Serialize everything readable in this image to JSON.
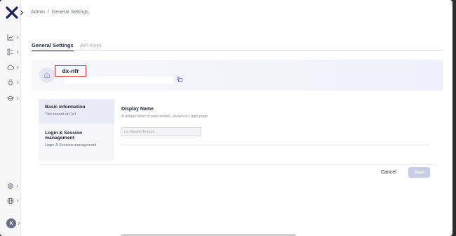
{
  "breadcrumb": {
    "root": "Admin",
    "separator": "/",
    "current": "General Settings"
  },
  "tabs": [
    {
      "label": "General Settings",
      "active": true
    },
    {
      "label": "API Keys",
      "active": false
    }
  ],
  "tenant": {
    "name": "dx-nfr",
    "id_value": ""
  },
  "side_tabs": [
    {
      "title": "Basic information",
      "subtitle": "This tenant at Cx1"
    },
    {
      "title": "Login & Session management",
      "subtitle": "Login & Session management"
    }
  ],
  "form": {
    "display_name_label": "Display Name",
    "display_name_desc": "A unique label of your tenant, shown in Login page",
    "display_name_placeholder": "i.e. MasterTenant"
  },
  "footer": {
    "cancel_label": "Cancel",
    "save_label": "Save"
  },
  "user": {
    "avatar_initial": "K"
  },
  "sidebar_icons": [
    "chart-icon",
    "list-icon",
    "cloud-icon",
    "bug-icon",
    "graduation-cap-icon",
    "settings-icon",
    "globe-icon"
  ],
  "colors": {
    "accent": "#1f2235",
    "save_disabled": "#c9cce6",
    "highlight_border": "#d9302b",
    "logo": "#1b1f5e"
  }
}
